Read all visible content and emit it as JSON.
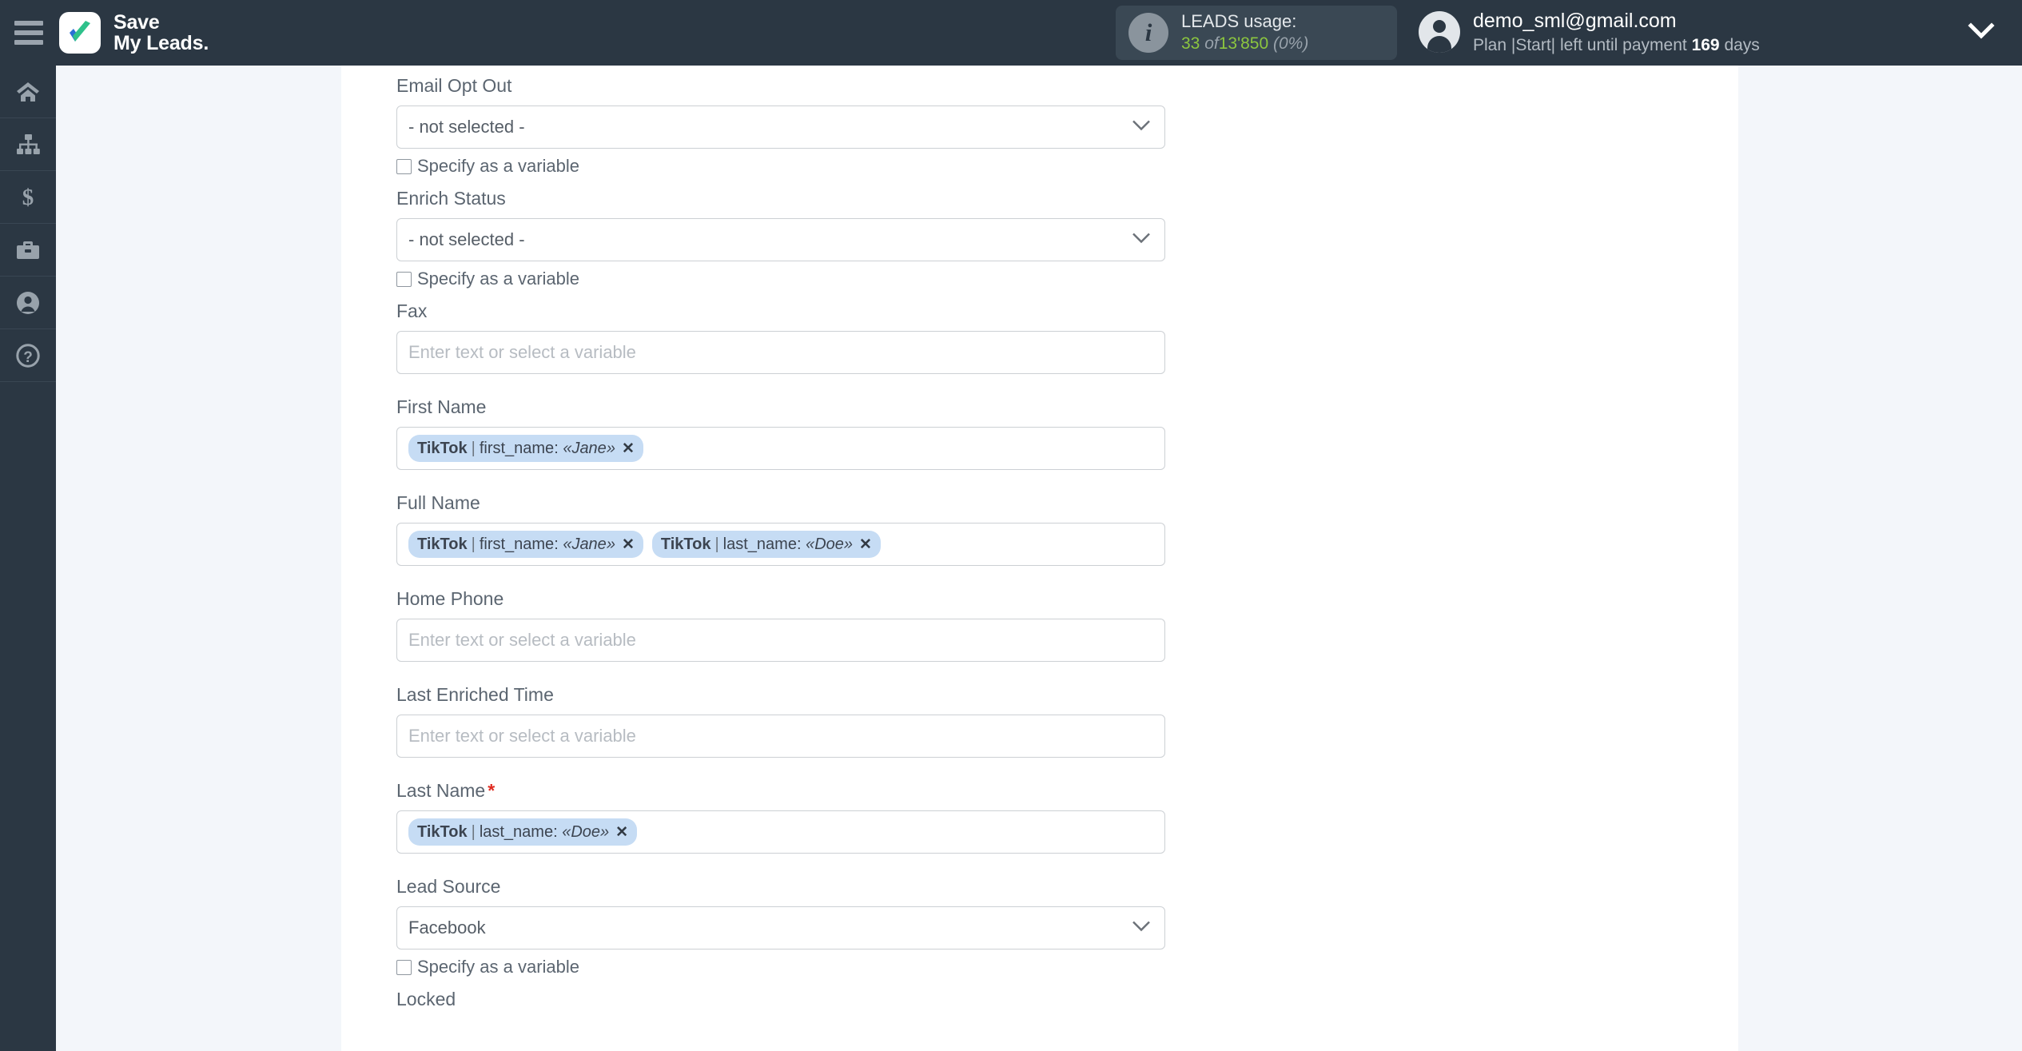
{
  "header": {
    "menu_icon": "hamburger-icon",
    "logo_line1": "Save",
    "logo_line2": "My Leads.",
    "leads_usage": {
      "info_icon": "info-icon",
      "title": "LEADS usage:",
      "used": "33",
      "of": "of",
      "total": "13'850",
      "percent": "(0%)"
    },
    "account": {
      "avatar_icon": "user-avatar-icon",
      "email": "demo_sml@gmail.com",
      "plan_prefix": "Plan |Start| left until payment",
      "days": "169",
      "plan_suffix": "days",
      "chevron_icon": "chevron-down-icon"
    }
  },
  "sidebar": {
    "items": [
      {
        "icon": "home-icon",
        "name": "sidebar-item-home"
      },
      {
        "icon": "sitemap-icon",
        "name": "sidebar-item-connections"
      },
      {
        "icon": "dollar-icon",
        "name": "sidebar-item-billing"
      },
      {
        "icon": "briefcase-icon",
        "name": "sidebar-item-business"
      },
      {
        "icon": "user-circle-icon",
        "name": "sidebar-item-account"
      },
      {
        "icon": "question-circle-icon",
        "name": "sidebar-item-help"
      }
    ]
  },
  "form": {
    "checkbox_label": "Specify as a variable",
    "placeholder": "Enter text or select a variable",
    "not_selected": "- not selected -",
    "required_mark": "*",
    "fields": [
      {
        "label": "Email Opt Out",
        "type": "select",
        "value": "- not selected -",
        "has_checkbox": true
      },
      {
        "label": "Enrich Status",
        "type": "select",
        "value": "- not selected -",
        "has_checkbox": true
      },
      {
        "label": "Fax",
        "type": "text",
        "value": "",
        "has_checkbox": false
      },
      {
        "label": "First Name",
        "type": "chips",
        "has_checkbox": false,
        "chips": [
          {
            "source": "TikTok",
            "field": "first_name",
            "value": "Jane"
          }
        ]
      },
      {
        "label": "Full Name",
        "type": "chips",
        "has_checkbox": false,
        "chips": [
          {
            "source": "TikTok",
            "field": "first_name",
            "value": "Jane"
          },
          {
            "source": "TikTok",
            "field": "last_name",
            "value": "Doe"
          }
        ]
      },
      {
        "label": "Home Phone",
        "type": "text",
        "value": "",
        "has_checkbox": false
      },
      {
        "label": "Last Enriched Time",
        "type": "text",
        "value": "",
        "has_checkbox": false
      },
      {
        "label": "Last Name",
        "type": "chips",
        "required": true,
        "has_checkbox": false,
        "chips": [
          {
            "source": "TikTok",
            "field": "last_name",
            "value": "Doe"
          }
        ]
      },
      {
        "label": "Lead Source",
        "type": "select",
        "value": "Facebook",
        "has_checkbox": true
      },
      {
        "label": "Locked",
        "type": "cutoff",
        "has_checkbox": false
      }
    ]
  },
  "colors": {
    "header_bg": "#2b3743",
    "page_bg": "#f3f6fa",
    "chip_bg": "#c6dcf4",
    "accent_green": "#8cc63f",
    "required_red": "#e02b20"
  }
}
